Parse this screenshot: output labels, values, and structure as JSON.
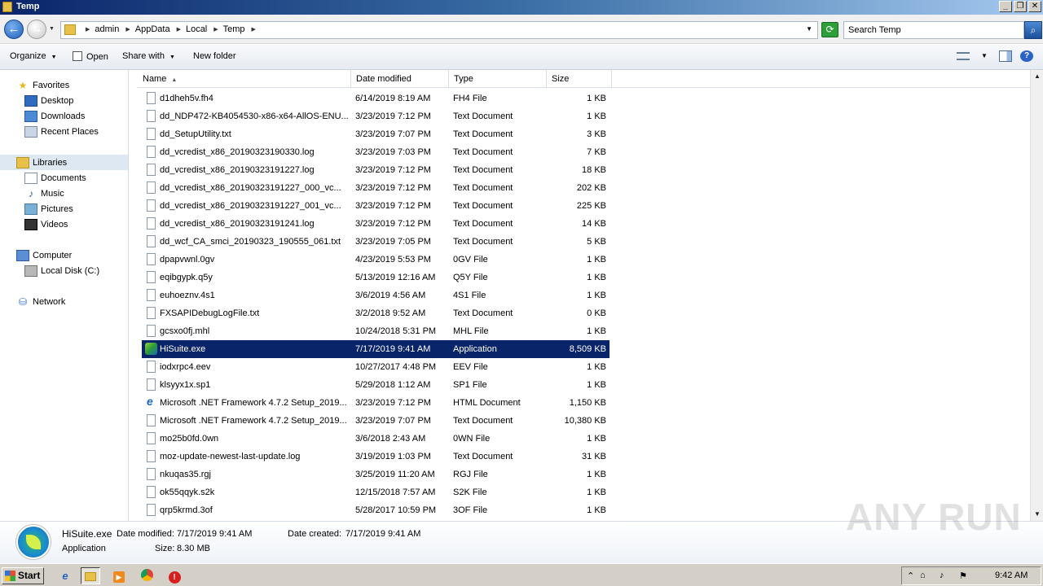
{
  "window": {
    "title": "Temp"
  },
  "address": {
    "crumbs": [
      "admin",
      "AppData",
      "Local",
      "Temp"
    ],
    "search_placeholder": "Search Temp"
  },
  "toolbar": {
    "organize": "Organize",
    "open": "Open",
    "share_with": "Share with",
    "new_folder": "New folder"
  },
  "nav": {
    "favorites": "Favorites",
    "desktop": "Desktop",
    "downloads": "Downloads",
    "recent": "Recent Places",
    "libraries": "Libraries",
    "documents": "Documents",
    "music": "Music",
    "pictures": "Pictures",
    "videos": "Videos",
    "computer": "Computer",
    "local_disk": "Local Disk (C:)",
    "network": "Network"
  },
  "columns": {
    "name": "Name",
    "date": "Date modified",
    "type": "Type",
    "size": "Size"
  },
  "files": [
    {
      "name": "d1dheh5v.fh4",
      "date": "6/14/2019 8:19 AM",
      "type": "FH4 File",
      "size": "1 KB",
      "icon": "file"
    },
    {
      "name": "dd_NDP472-KB4054530-x86-x64-AllOS-ENU...",
      "date": "3/23/2019 7:12 PM",
      "type": "Text Document",
      "size": "1 KB",
      "icon": "file"
    },
    {
      "name": "dd_SetupUtility.txt",
      "date": "3/23/2019 7:07 PM",
      "type": "Text Document",
      "size": "3 KB",
      "icon": "file"
    },
    {
      "name": "dd_vcredist_x86_20190323190330.log",
      "date": "3/23/2019 7:03 PM",
      "type": "Text Document",
      "size": "7 KB",
      "icon": "file"
    },
    {
      "name": "dd_vcredist_x86_20190323191227.log",
      "date": "3/23/2019 7:12 PM",
      "type": "Text Document",
      "size": "18 KB",
      "icon": "file"
    },
    {
      "name": "dd_vcredist_x86_20190323191227_000_vc...",
      "date": "3/23/2019 7:12 PM",
      "type": "Text Document",
      "size": "202 KB",
      "icon": "file"
    },
    {
      "name": "dd_vcredist_x86_20190323191227_001_vc...",
      "date": "3/23/2019 7:12 PM",
      "type": "Text Document",
      "size": "225 KB",
      "icon": "file"
    },
    {
      "name": "dd_vcredist_x86_20190323191241.log",
      "date": "3/23/2019 7:12 PM",
      "type": "Text Document",
      "size": "14 KB",
      "icon": "file"
    },
    {
      "name": "dd_wcf_CA_smci_20190323_190555_061.txt",
      "date": "3/23/2019 7:05 PM",
      "type": "Text Document",
      "size": "5 KB",
      "icon": "file"
    },
    {
      "name": "dpapvwnl.0gv",
      "date": "4/23/2019 5:53 PM",
      "type": "0GV File",
      "size": "1 KB",
      "icon": "file"
    },
    {
      "name": "eqibgypk.q5y",
      "date": "5/13/2019 12:16 AM",
      "type": "Q5Y File",
      "size": "1 KB",
      "icon": "file"
    },
    {
      "name": "euhoeznv.4s1",
      "date": "3/6/2019 4:56 AM",
      "type": "4S1 File",
      "size": "1 KB",
      "icon": "file"
    },
    {
      "name": "FXSAPIDebugLogFile.txt",
      "date": "3/2/2018 9:52 AM",
      "type": "Text Document",
      "size": "0 KB",
      "icon": "file"
    },
    {
      "name": "gcsxo0fj.mhl",
      "date": "10/24/2018 5:31 PM",
      "type": "MHL File",
      "size": "1 KB",
      "icon": "file"
    },
    {
      "name": "HiSuite.exe",
      "date": "7/17/2019 9:41 AM",
      "type": "Application",
      "size": "8,509 KB",
      "icon": "exe",
      "selected": true
    },
    {
      "name": "iodxrpc4.eev",
      "date": "10/27/2017 4:48 PM",
      "type": "EEV File",
      "size": "1 KB",
      "icon": "file"
    },
    {
      "name": "klsyyx1x.sp1",
      "date": "5/29/2018 1:12 AM",
      "type": "SP1 File",
      "size": "1 KB",
      "icon": "file"
    },
    {
      "name": "Microsoft .NET Framework 4.7.2 Setup_2019...",
      "date": "3/23/2019 7:12 PM",
      "type": "HTML Document",
      "size": "1,150 KB",
      "icon": "html"
    },
    {
      "name": "Microsoft .NET Framework 4.7.2 Setup_2019...",
      "date": "3/23/2019 7:07 PM",
      "type": "Text Document",
      "size": "10,380 KB",
      "icon": "file"
    },
    {
      "name": "mo25b0fd.0wn",
      "date": "3/6/2018 2:43 AM",
      "type": "0WN File",
      "size": "1 KB",
      "icon": "file"
    },
    {
      "name": "moz-update-newest-last-update.log",
      "date": "3/19/2019 1:03 PM",
      "type": "Text Document",
      "size": "31 KB",
      "icon": "file"
    },
    {
      "name": "nkuqas35.rgj",
      "date": "3/25/2019 11:20 AM",
      "type": "RGJ File",
      "size": "1 KB",
      "icon": "file"
    },
    {
      "name": "ok55qqyk.s2k",
      "date": "12/15/2018 7:57 AM",
      "type": "S2K File",
      "size": "1 KB",
      "icon": "file"
    },
    {
      "name": "qrp5krmd.3of",
      "date": "5/28/2017 10:59 PM",
      "type": "3OF File",
      "size": "1 KB",
      "icon": "file"
    }
  ],
  "details": {
    "name": "HiSuite.exe",
    "type": "Application",
    "modified_label": "Date modified:",
    "modified_value": "7/17/2019 9:41 AM",
    "created_label": "Date created:",
    "created_value": "7/17/2019 9:41 AM",
    "size_label": "Size:",
    "size_value": "8.30 MB"
  },
  "taskbar": {
    "start": "Start",
    "clock": "9:42 AM"
  },
  "watermark": "ANY RUN"
}
